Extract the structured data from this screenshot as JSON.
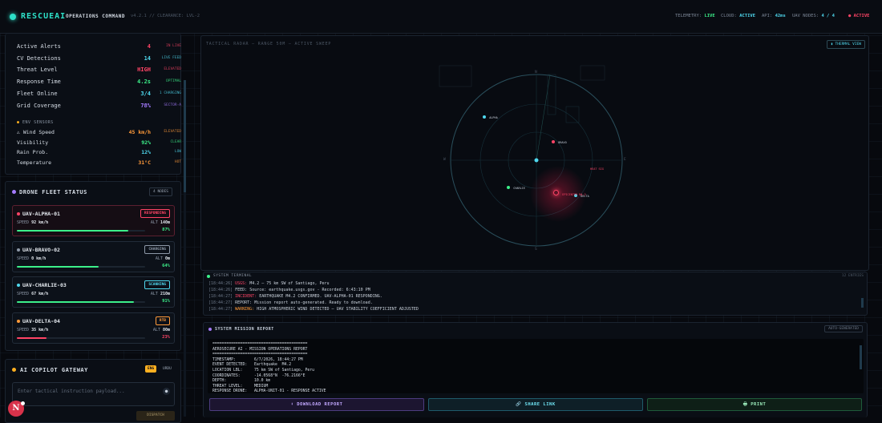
{
  "header": {
    "brand": "RESCUEAI",
    "subtitle": "OPERATIONS COMMAND",
    "version": "v4.2.1 // CLEARANCE: LVL-2",
    "telemetry_label": "TELEMETRY:",
    "telemetry_value": "LIVE",
    "cloud_label": "CLOUD:",
    "cloud_value": "ACTIVE",
    "api_label": "API:",
    "api_value": "42ms",
    "uav_label": "UAV NODES:",
    "uav_value": "4 / 4",
    "status": "● ACTIVE"
  },
  "metrics": [
    {
      "label": "Active Alerts",
      "value": "4",
      "tag": "IN LIVE",
      "color": "#ff4466"
    },
    {
      "label": "CV Detections",
      "value": "14",
      "tag": "LIVE FEED",
      "color": "#4fd8ee"
    },
    {
      "label": "Threat Level",
      "value": "HIGH",
      "tag": "ELEVATED",
      "color": "#ff4466"
    },
    {
      "label": "Response Time",
      "value": "4.2s",
      "tag": "OPTIMAL",
      "color": "#3cf08a"
    },
    {
      "label": "Fleet Online",
      "value": "3/4",
      "tag": "1 CHARGING",
      "color": "#4fd8ee"
    },
    {
      "label": "Grid Coverage",
      "value": "78%",
      "tag": "SECTOR-A",
      "color": "#a57bff"
    }
  ],
  "env": {
    "heading": "ENV SENSORS",
    "rows": [
      {
        "label": "⚠ Wind Speed",
        "value": "45 km/h",
        "tag": "ELEVATED",
        "color": "#ff9a3a"
      },
      {
        "label": "Visibility",
        "value": "92%",
        "tag": "CLEAR",
        "color": "#3cf08a"
      },
      {
        "label": "Rain Prob.",
        "value": "12%",
        "tag": "LOW",
        "color": "#4fd8ee"
      },
      {
        "label": "Temperature",
        "value": "31°C",
        "tag": "HOT",
        "color": "#ff9a3a"
      }
    ]
  },
  "fleet": {
    "title": "DRONE FLEET STATUS",
    "count": "4 NODES",
    "drones": [
      {
        "name": "UAV-ALPHA-01",
        "status": "RESPONDING",
        "speed_label": "SPEED",
        "speed": "92 km/h",
        "alt_label": "ALT",
        "alt": "140m",
        "battery": 87,
        "battery_label": "87%",
        "color": "#ff4466",
        "bar": "#3cf08a"
      },
      {
        "name": "UAV-BRAVO-02",
        "status": "CHARGING",
        "speed_label": "SPEED",
        "speed": "0 km/h",
        "alt_label": "ALT",
        "alt": "0m",
        "battery": 64,
        "battery_label": "64%",
        "color": "#8d98a7",
        "bar": "#3cf08a"
      },
      {
        "name": "UAV-CHARLIE-03",
        "status": "SCANNING",
        "speed_label": "SPEED",
        "speed": "67 km/h",
        "alt_label": "ALT",
        "alt": "210m",
        "battery": 91,
        "battery_label": "91%",
        "color": "#4fd8ee",
        "bar": "#3cf08a"
      },
      {
        "name": "UAV-DELTA-04",
        "status": "RTB",
        "speed_label": "SPEED",
        "speed": "35 km/h",
        "alt_label": "ALT",
        "alt": "80m",
        "battery": 23,
        "battery_label": "23%",
        "color": "#ff9a3a",
        "bar": "#ff4466"
      }
    ]
  },
  "copilot": {
    "title": "AI COPILOT GATEWAY",
    "lang_active": "ENG",
    "lang_other": "URDU",
    "placeholder": "Enter tactical instruction payload...",
    "dispatch": "DISPATCH"
  },
  "radar": {
    "title": "TACTICAL RADAR — RANGE 50M — ACTIVE SWEEP",
    "thermal": "▮ THERMAL VIEW",
    "labels": {
      "a": "ALPHA",
      "b": "BRAVO",
      "c": "CHARLIE",
      "d": "DELTA",
      "incident": "EPICENTER M4.2",
      "n": "N",
      "s": "S",
      "e": "E",
      "w": "W",
      "heat": "HEAT SIG"
    }
  },
  "terminal": {
    "title": "SYSTEM TERMINAL",
    "count": "12 ENTRIES",
    "lines": [
      {
        "time": "[18:44:26]",
        "tag": "USGS:",
        "tag_color": "#ff4466",
        "text": " M4.2 — 75 km SW of Santiago, Peru"
      },
      {
        "time": "[18:44:26]",
        "tag": "FEED:",
        "tag_color": "#c9d1db",
        "text": " Source: earthquake.usgs.gov - Recorded: 6:43:10 PM"
      },
      {
        "time": "[18:44:27]",
        "tag": "INCIDENT:",
        "tag_color": "#ff4466",
        "text": " EARTHQUAKE M4.2 CONFIRMED. UAV-ALPHA-01 RESPONDING."
      },
      {
        "time": "[18:44:27]",
        "tag": "REPORT:",
        "tag_color": "#c9d1db",
        "text": " Mission report auto-generated. Ready to download."
      },
      {
        "time": "[18:44:27]",
        "tag": "WARNING:",
        "tag_color": "#ff9a3a",
        "text": " HIGH ATMOSPHERIC WIND DETECTED — UAV STABILITY COEFFICIENT ADJUSTED"
      }
    ]
  },
  "report": {
    "title": "SYSTEM MISSION REPORT",
    "badge": "AUTO-GENERATED",
    "lines": [
      "=========================================",
      "AEROSECURE AI - MISSION OPERATIONS REPORT",
      "=========================================",
      "TIMESTAMP:        6/7/2026, 18:44:27 PM",
      "EVENT DETECTED:   Earthquake  M4.2",
      "LOCATION LBL:     75 km SW of Santiago, Peru",
      "COORDINATES:      -14.0568°N  -76.2166°E",
      "DEPTH:            10.0 km",
      "THREAT LEVEL:     MEDIUM",
      "RESPONSE DRONE:   ALPHA-UNIT-01 - RESPONSE ACTIVE"
    ],
    "download": "⬇ DOWNLOAD REPORT",
    "share": "🔗 SHARE LINK",
    "print": "🖶 PRINT"
  },
  "avatar": "N"
}
